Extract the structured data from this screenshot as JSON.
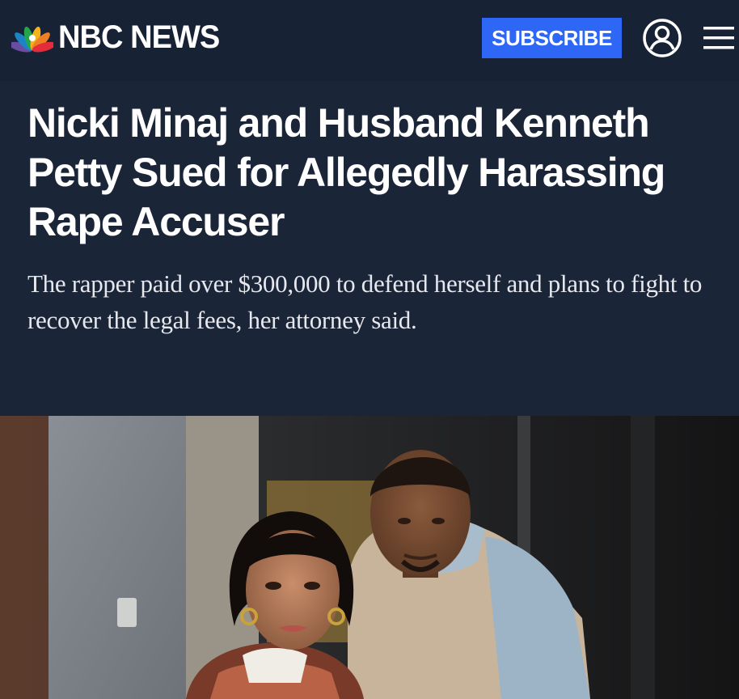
{
  "header": {
    "logo_text": "NBC NEWS",
    "subscribe_label": "SUBSCRIBE",
    "account_icon": "account-icon",
    "menu_icon": "hamburger-menu-icon"
  },
  "article": {
    "headline": "Nicki Minaj and Husband Kenneth Petty Sued for Allegedly Harassing Rape Accuser",
    "dek": "The rapper paid over $300,000 to defend herself and plans to fight to recover the legal fees, her attorney said."
  },
  "colors": {
    "header_bg": "#172235",
    "hero_bg": "#1b2538",
    "subscribe_bg": "#2e67f5",
    "text": "#ffffff"
  }
}
